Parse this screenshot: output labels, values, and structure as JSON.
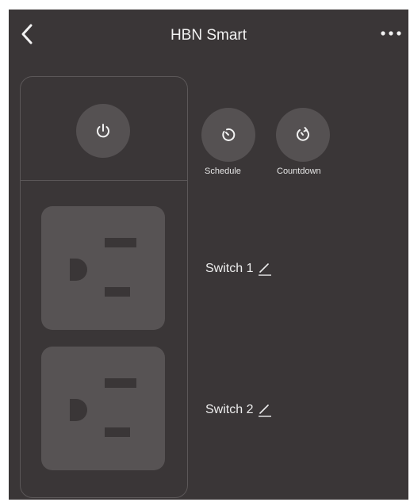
{
  "header": {
    "title": "HBN Smart",
    "back_icon": "chevron-left-icon",
    "more_icon": "more-horizontal-icon"
  },
  "controls": {
    "power_icon": "power-icon",
    "schedule_label": "Schedule",
    "schedule_icon": "schedule-icon",
    "countdown_label": "Countdown",
    "countdown_icon": "countdown-icon"
  },
  "switches": [
    {
      "label": "Switch 1",
      "icon": "edit-pencil-icon"
    },
    {
      "label": "Switch 2",
      "icon": "edit-pencil-icon"
    }
  ],
  "colors": {
    "background": "#3a3637",
    "button": "#555152",
    "outlet": "#575354",
    "text": "#ececec"
  }
}
